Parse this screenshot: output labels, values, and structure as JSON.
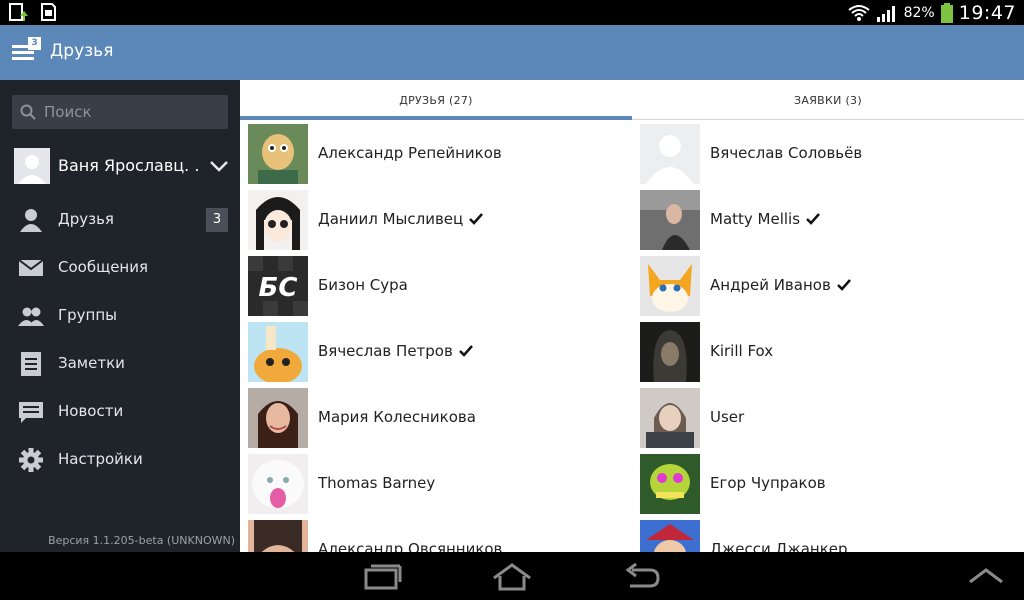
{
  "status": {
    "battery_pct": "82%",
    "time": "19:47"
  },
  "appbar": {
    "title": "Друзья",
    "menu_badge": "3"
  },
  "sidebar": {
    "search_placeholder": "Поиск",
    "profile_name": "Ваня Ярославц. .",
    "items": [
      {
        "label": "Друзья",
        "icon": "person-icon",
        "count": "3"
      },
      {
        "label": "Сообщения",
        "icon": "envelope-icon"
      },
      {
        "label": "Группы",
        "icon": "group-icon"
      },
      {
        "label": "Заметки",
        "icon": "notes-icon"
      },
      {
        "label": "Новости",
        "icon": "news-icon"
      },
      {
        "label": "Настройки",
        "icon": "gear-icon"
      }
    ],
    "version": "Версия 1.1.205-beta (UNKNOWN)"
  },
  "tabs": {
    "friends": "ДРУЗЬЯ (27)",
    "requests": "ЗАЯВКИ (3)"
  },
  "friends_left": [
    {
      "name": "Александр Репейников",
      "verified": false
    },
    {
      "name": "Даниил Мысливец",
      "verified": true
    },
    {
      "name": "Бизон Сура",
      "verified": false,
      "avatar_text": "БС"
    },
    {
      "name": "Вячеслав Петров",
      "verified": true
    },
    {
      "name": "Мария Колесникова",
      "verified": false
    },
    {
      "name": "Thomas Barney",
      "verified": false
    },
    {
      "name": "Александр Овсянников",
      "verified": false
    }
  ],
  "friends_right": [
    {
      "name": "Вячеслав Соловьёв",
      "verified": false
    },
    {
      "name": "Matty Mellis",
      "verified": true
    },
    {
      "name": "Андрей Иванов",
      "verified": true
    },
    {
      "name": "Kirill Fox",
      "verified": false
    },
    {
      "name": "User",
      "verified": false
    },
    {
      "name": "Егор Чупраков",
      "verified": false
    },
    {
      "name": "Джесси Джанкер",
      "verified": false
    }
  ],
  "colors": {
    "accent": "#5b87b9",
    "sidebar_bg": "#1f232a"
  }
}
